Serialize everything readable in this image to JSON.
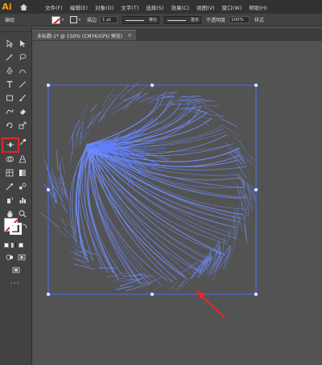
{
  "app": {
    "logo": "Ai",
    "home_icon": "home-icon"
  },
  "menus": [
    "文件(F)",
    "编辑(E)",
    "对象(O)",
    "文字(T)",
    "选择(S)",
    "效果(C)",
    "视图(V)",
    "窗口(W)",
    "帮助(H)"
  ],
  "control_bar": {
    "label": "编组",
    "stroke_label": "描边",
    "stroke_weight": "1 pt",
    "profile_label": "等比",
    "brush_label": "基本",
    "opacity_label": "不透明度",
    "opacity_value": "100%",
    "style_label": "样式"
  },
  "document_tab": {
    "title": "未标题-1* @ 150% (CMYK/GPU 预览)",
    "close": "×"
  },
  "colors": {
    "accent_orange": "#ff9a00",
    "highlight_red": "#e0262b",
    "selection_blue": "#4a6cf0",
    "fiber_blue": "#6f8dff",
    "arrow_red": "#e02a2a"
  }
}
